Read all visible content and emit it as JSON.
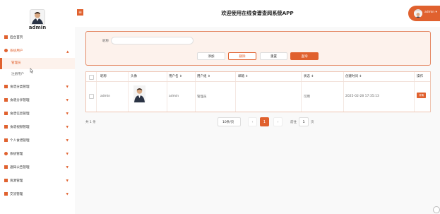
{
  "app": {
    "title": "欢迎使用在线食谱查阅系统APP",
    "accent": "#e0612e"
  },
  "sidebar": {
    "username": "admin",
    "items": [
      {
        "label": "后台首页",
        "icon": "home-icon"
      },
      {
        "label": "系统用户",
        "icon": "user-icon",
        "expanded": true
      },
      {
        "label": "管理员",
        "icon": "",
        "active": true
      },
      {
        "label": "注册用户",
        "icon": ""
      },
      {
        "label": "食谱分类管理",
        "icon": "grid-icon"
      },
      {
        "label": "食谱分享管理",
        "icon": "grid-icon"
      },
      {
        "label": "食谱信息管理",
        "icon": "grid-icon"
      },
      {
        "label": "食谱视频管理",
        "icon": "grid-icon"
      },
      {
        "label": "个人食谱管理",
        "icon": "grid-icon"
      },
      {
        "label": "系统管理",
        "icon": "gear-icon"
      },
      {
        "label": "通知公告管理",
        "icon": "bell-icon"
      },
      {
        "label": "资源管理",
        "icon": "folder-icon"
      },
      {
        "label": "交流管理",
        "icon": "chat-icon"
      }
    ]
  },
  "header": {
    "user_label": "admin ▾"
  },
  "search": {
    "label": "昵称",
    "value": "",
    "placeholder": ""
  },
  "buttons": {
    "add": "添加",
    "delete": "删除",
    "reset": "重置",
    "query": "查询"
  },
  "table": {
    "headers": [
      "昵称",
      "头像",
      "用户名 ⇕",
      "用户组 ⇕",
      "邮箱 ⇕",
      "状态 ⇕",
      "创建时间 ⇕",
      "操作"
    ],
    "rows": [
      {
        "nickname": "admin",
        "username": "admin",
        "group": "管理员",
        "email": "",
        "status": "可用",
        "created": "2025-02-28 17:35:13",
        "action": "详情"
      }
    ]
  },
  "pagination": {
    "total": "共 1 条",
    "page_size": "10条/页",
    "prev": "‹",
    "current": "1",
    "next": "›",
    "goto_label": "前往",
    "goto_value": "1",
    "goto_unit": "页"
  }
}
